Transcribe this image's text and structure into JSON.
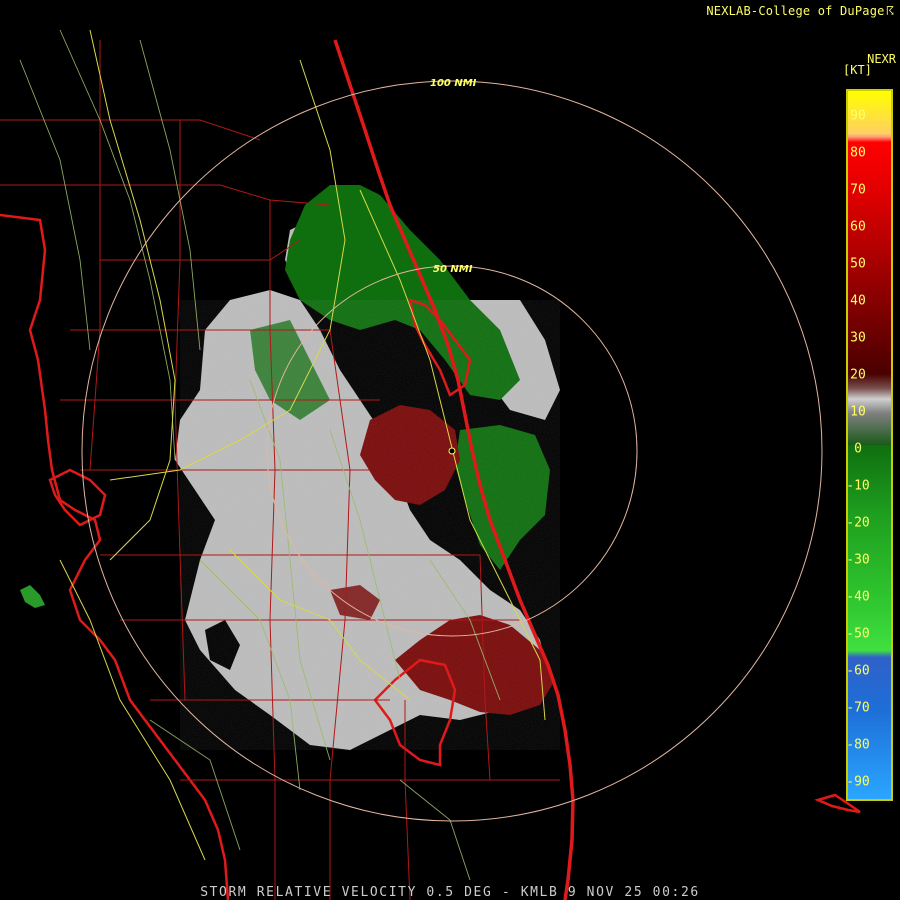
{
  "credit": {
    "text": "NEXLAB-College of DuPage",
    "mark": "☈"
  },
  "product_code": "NEXR",
  "legend": {
    "unit": "[KT]",
    "ticks": [
      "90",
      "80",
      "70",
      "60",
      "50",
      "40",
      "30",
      "20",
      "10",
      "0",
      "-10",
      "-20",
      "-30",
      "-40",
      "-50",
      "-60",
      "-70",
      "-80",
      "-90"
    ],
    "range": [
      -95,
      95
    ]
  },
  "range_rings": [
    {
      "label": "100 NMI"
    },
    {
      "label": "50 NMI"
    }
  ],
  "footer": "STORM RELATIVE VELOCITY 0.5 DEG - KMLB 9 NOV 25 00:26",
  "colors": {
    "background": "#000000",
    "inbound_green": "#0f6f0f",
    "outbound_red": "#7a0a0a",
    "near_zero_gray": "#bdbdbd",
    "state_lines": "#cc1f1f",
    "roads": "#9bbb6b",
    "highways": "#d8d84a",
    "range_rings": "#e3b6a0",
    "colorbar_border": "#cccc00"
  }
}
